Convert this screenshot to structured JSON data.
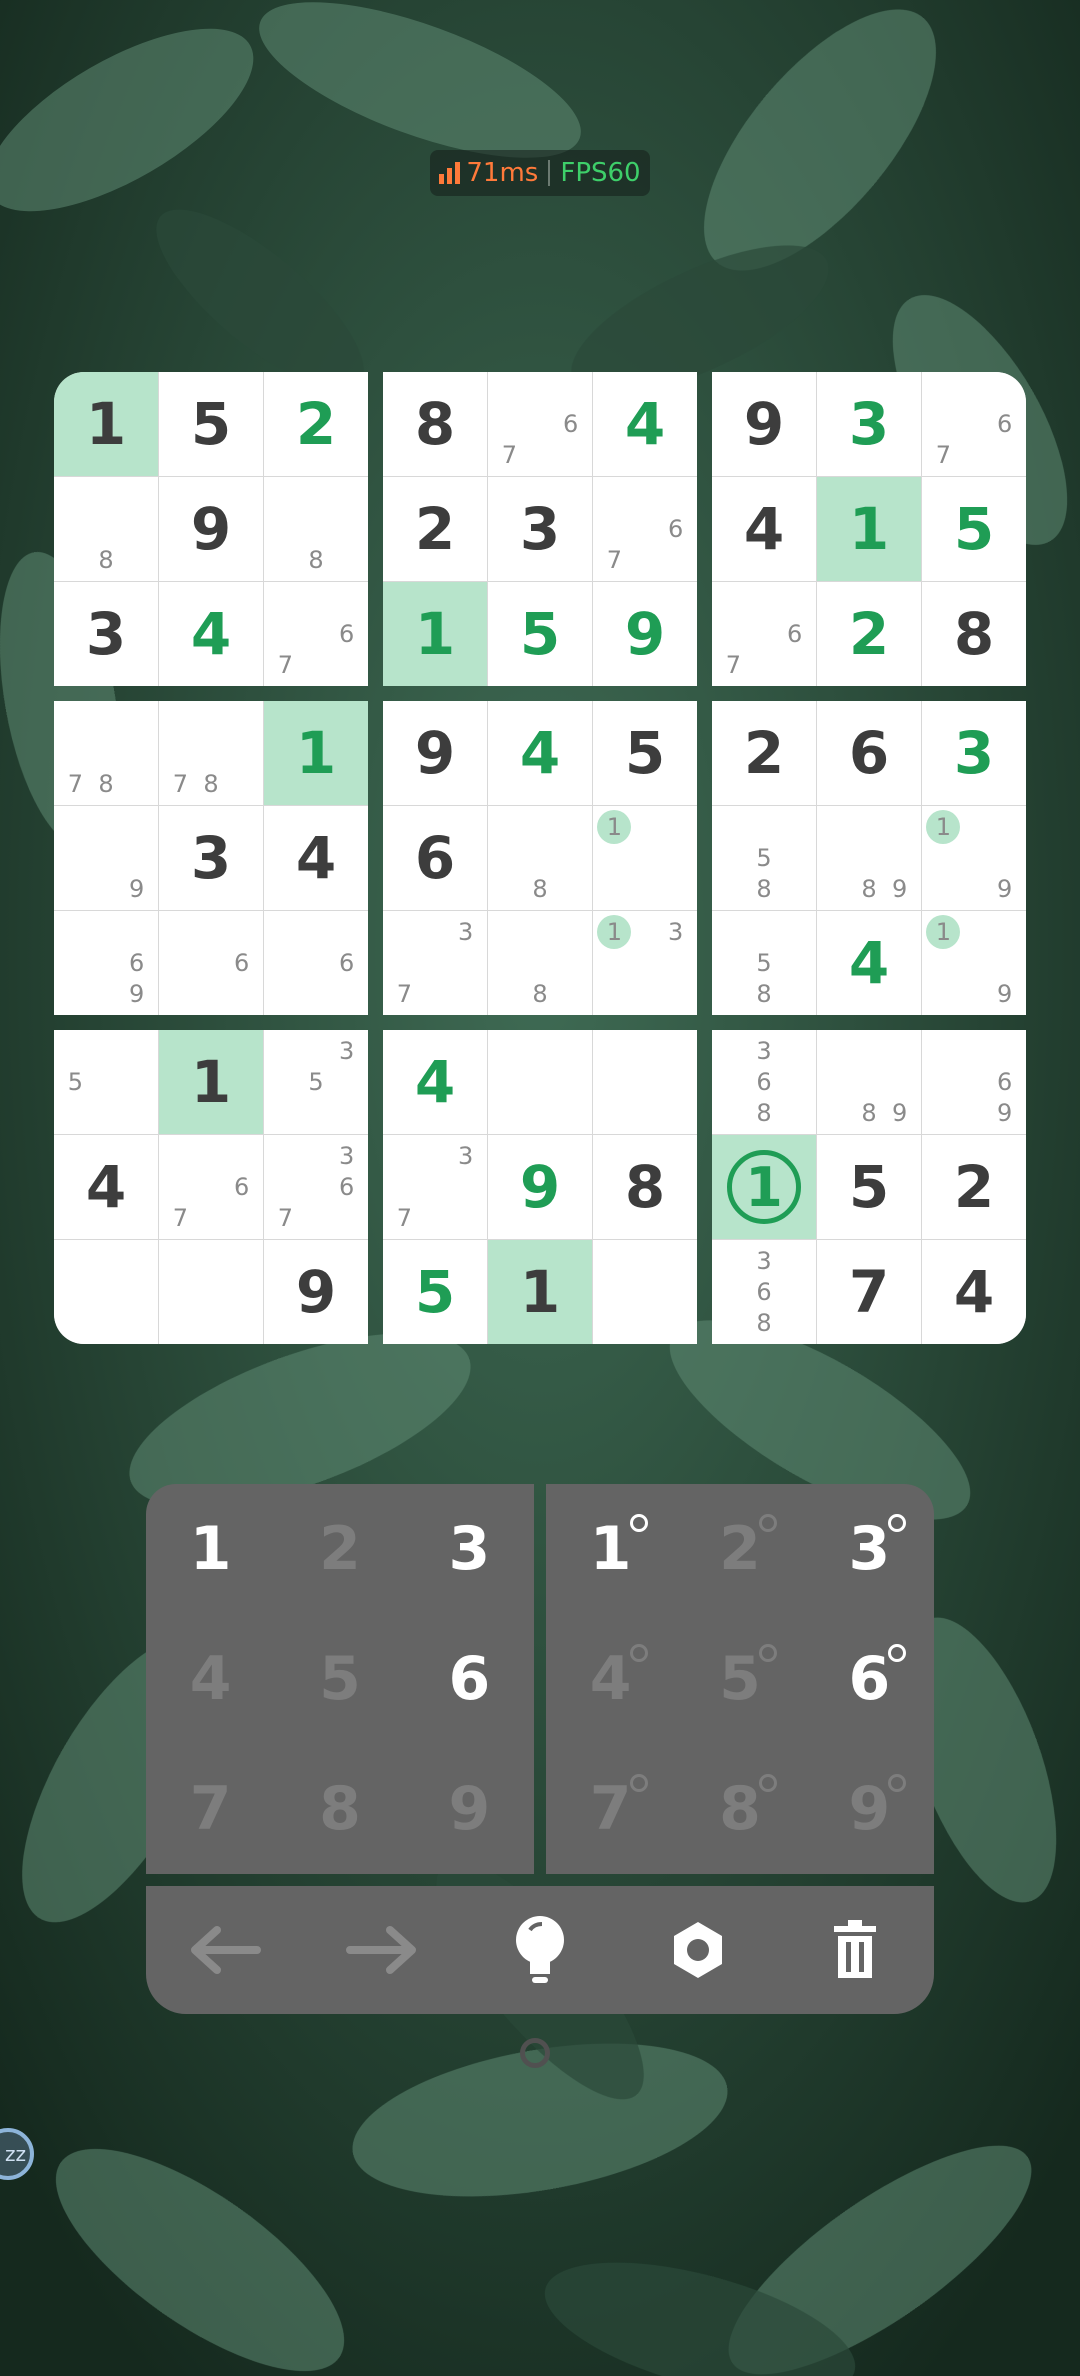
{
  "status": {
    "ping": "71ms",
    "fps": "FPS60"
  },
  "colors": {
    "given": "#3d3d3d",
    "user_entry": "#1f9d55",
    "highlight": "#b7e4cb",
    "pad_bg": "#646464"
  },
  "board": {
    "boxes": [
      {
        "cells": [
          {
            "v": "1",
            "type": "given",
            "hl": true
          },
          {
            "v": "5",
            "type": "given"
          },
          {
            "v": "2",
            "type": "user"
          },
          {
            "notes": [
              "",
              "",
              "",
              "",
              "",
              "",
              "",
              "8",
              ""
            ]
          },
          {
            "v": "9",
            "type": "given"
          },
          {
            "notes": [
              "",
              "",
              "",
              "",
              "",
              "",
              "",
              "8",
              ""
            ]
          },
          {
            "v": "3",
            "type": "given"
          },
          {
            "v": "4",
            "type": "user"
          },
          {
            "notes": [
              "",
              "",
              "",
              "",
              "",
              "6",
              "7",
              "",
              ""
            ]
          }
        ]
      },
      {
        "cells": [
          {
            "v": "8",
            "type": "given"
          },
          {
            "notes": [
              "",
              "",
              "",
              "",
              "",
              "6",
              "7",
              "",
              ""
            ]
          },
          {
            "v": "4",
            "type": "user"
          },
          {
            "v": "2",
            "type": "given"
          },
          {
            "v": "3",
            "type": "given"
          },
          {
            "notes": [
              "",
              "",
              "",
              "",
              "",
              "6",
              "7",
              "",
              ""
            ]
          },
          {
            "v": "1",
            "type": "user",
            "hl": true
          },
          {
            "v": "5",
            "type": "user"
          },
          {
            "v": "9",
            "type": "user"
          }
        ]
      },
      {
        "cells": [
          {
            "v": "9",
            "type": "given"
          },
          {
            "v": "3",
            "type": "user"
          },
          {
            "notes": [
              "",
              "",
              "",
              "",
              "",
              "6",
              "7",
              "",
              ""
            ]
          },
          {
            "v": "4",
            "type": "given"
          },
          {
            "v": "1",
            "type": "user",
            "hl": true
          },
          {
            "v": "5",
            "type": "user"
          },
          {
            "notes": [
              "",
              "",
              "",
              "",
              "",
              "6",
              "7",
              "",
              ""
            ]
          },
          {
            "v": "2",
            "type": "user"
          },
          {
            "v": "8",
            "type": "given"
          }
        ]
      },
      {
        "cells": [
          {
            "notes": [
              "",
              "",
              "",
              "",
              "",
              "",
              "7",
              "8",
              ""
            ]
          },
          {
            "notes": [
              "",
              "",
              "",
              "",
              "",
              "",
              "7",
              "8",
              ""
            ]
          },
          {
            "v": "1",
            "type": "user",
            "hl": true
          },
          {
            "notes": [
              "",
              "",
              "",
              "",
              "",
              "",
              "",
              "",
              "9"
            ]
          },
          {
            "v": "3",
            "type": "given"
          },
          {
            "v": "4",
            "type": "given"
          },
          {
            "notes": [
              "",
              "",
              "",
              "",
              "",
              "6",
              "",
              "",
              "9"
            ]
          },
          {
            "notes": [
              "",
              "",
              "",
              "",
              "",
              "6",
              "",
              "",
              ""
            ]
          },
          {
            "notes": [
              "",
              "",
              "",
              "",
              "",
              "6",
              "",
              "",
              ""
            ]
          }
        ]
      },
      {
        "cells": [
          {
            "v": "9",
            "type": "given"
          },
          {
            "v": "4",
            "type": "user"
          },
          {
            "v": "5",
            "type": "given"
          },
          {
            "v": "6",
            "type": "given"
          },
          {
            "notes": [
              "",
              "",
              "",
              "",
              "",
              "",
              "",
              "8",
              ""
            ]
          },
          {
            "notes": [
              "1",
              "",
              "",
              "",
              "",
              "",
              "",
              "",
              ""
            ],
            "mark": [
              0
            ]
          },
          {
            "notes": [
              "",
              "",
              "3",
              "",
              "",
              "",
              "7",
              "",
              ""
            ]
          },
          {
            "notes": [
              "",
              "",
              "",
              "",
              "",
              "",
              "",
              "8",
              ""
            ]
          },
          {
            "notes": [
              "1",
              "",
              "3",
              "",
              "",
              "",
              "",
              "",
              ""
            ],
            "mark": [
              0
            ]
          }
        ]
      },
      {
        "cells": [
          {
            "v": "2",
            "type": "given"
          },
          {
            "v": "6",
            "type": "given"
          },
          {
            "v": "3",
            "type": "user"
          },
          {
            "notes": [
              "",
              "",
              "",
              "",
              "5",
              "",
              "",
              "8",
              ""
            ]
          },
          {
            "notes": [
              "",
              "",
              "",
              "",
              "",
              "",
              "",
              "8",
              "9"
            ]
          },
          {
            "notes": [
              "1",
              "",
              "",
              "",
              "",
              "",
              "",
              "",
              "9"
            ],
            "mark": [
              0
            ]
          },
          {
            "notes": [
              "",
              "",
              "",
              "",
              "5",
              "",
              "",
              "8",
              ""
            ]
          },
          {
            "v": "4",
            "type": "user"
          },
          {
            "notes": [
              "1",
              "",
              "",
              "",
              "",
              "",
              "",
              "",
              "9"
            ],
            "mark": [
              0
            ]
          }
        ]
      },
      {
        "cells": [
          {
            "notes": [
              "",
              "",
              "",
              "5",
              "",
              "",
              "",
              "",
              ""
            ]
          },
          {
            "v": "1",
            "type": "given",
            "hl": true
          },
          {
            "notes": [
              "",
              "",
              "3",
              "",
              "5",
              "",
              "",
              "",
              ""
            ]
          },
          {
            "v": "4",
            "type": "given"
          },
          {
            "notes": [
              "",
              "",
              "",
              "",
              "",
              "6",
              "7",
              "",
              ""
            ]
          },
          {
            "notes": [
              "",
              "",
              "3",
              "",
              "",
              "6",
              "7",
              "",
              ""
            ]
          },
          {
            "notes": [
              "",
              "",
              "",
              "",
              "",
              "",
              "",
              "",
              ""
            ]
          },
          {
            "notes": [
              "",
              "",
              "",
              "",
              "",
              "",
              "",
              "",
              ""
            ]
          },
          {
            "v": "9",
            "type": "given"
          }
        ]
      },
      {
        "cells": [
          {
            "v": "4",
            "type": "user"
          },
          {
            "notes": [
              "",
              "",
              "",
              "",
              "",
              "",
              "",
              "",
              ""
            ]
          },
          {
            "notes": [
              "",
              "",
              "",
              "",
              "",
              "",
              "",
              "",
              ""
            ]
          },
          {
            "notes": [
              "",
              "",
              "3",
              "",
              "",
              "",
              "7",
              "",
              ""
            ]
          },
          {
            "v": "9",
            "type": "user"
          },
          {
            "v": "8",
            "type": "given"
          },
          {
            "v": "5",
            "type": "user"
          },
          {
            "v": "1",
            "type": "given",
            "hl": true
          },
          {
            "notes": [
              "",
              "",
              "",
              "",
              "",
              "",
              "",
              "",
              ""
            ]
          }
        ]
      },
      {
        "cells": [
          {
            "notes": [
              "",
              "3",
              "",
              "",
              "6",
              "",
              "",
              "8",
              ""
            ]
          },
          {
            "notes": [
              "",
              "",
              "",
              "",
              "",
              "",
              "",
              "8",
              "9"
            ]
          },
          {
            "notes": [
              "",
              "",
              "",
              "",
              "",
              "6",
              "",
              "",
              "9"
            ]
          },
          {
            "v": "1",
            "type": "user",
            "hl": true,
            "sel": true
          },
          {
            "v": "5",
            "type": "given"
          },
          {
            "v": "2",
            "type": "given"
          },
          {
            "notes": [
              "",
              "3",
              "",
              "",
              "6",
              "",
              "",
              "8",
              ""
            ]
          },
          {
            "v": "7",
            "type": "given"
          },
          {
            "v": "4",
            "type": "given"
          }
        ]
      }
    ]
  },
  "number_pad": {
    "keys": [
      {
        "label": "1",
        "enabled": true
      },
      {
        "label": "2",
        "enabled": false
      },
      {
        "label": "3",
        "enabled": true
      },
      {
        "label": "4",
        "enabled": false
      },
      {
        "label": "5",
        "enabled": false
      },
      {
        "label": "6",
        "enabled": true
      },
      {
        "label": "7",
        "enabled": false
      },
      {
        "label": "8",
        "enabled": false
      },
      {
        "label": "9",
        "enabled": false
      }
    ]
  },
  "notes_pad": {
    "keys": [
      {
        "label": "1",
        "enabled": true
      },
      {
        "label": "2",
        "enabled": false
      },
      {
        "label": "3",
        "enabled": true
      },
      {
        "label": "4",
        "enabled": false
      },
      {
        "label": "5",
        "enabled": false
      },
      {
        "label": "6",
        "enabled": true
      },
      {
        "label": "7",
        "enabled": false
      },
      {
        "label": "8",
        "enabled": false
      },
      {
        "label": "9",
        "enabled": false
      }
    ]
  },
  "toolbar": {
    "tools": [
      "arrow-left-icon",
      "arrow-right-icon",
      "lightbulb-icon",
      "gear-icon",
      "trash-icon"
    ]
  },
  "side_bubble": {
    "label": "zz"
  }
}
